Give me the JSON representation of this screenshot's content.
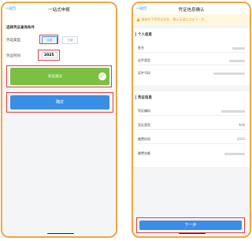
{
  "left": {
    "back_label": "<返回",
    "title": "一站式申报",
    "section_title": "选择凭证查询条件",
    "cert_type_label": "凭证类型",
    "cert_type_options": [
      "实收",
      "已缴"
    ],
    "cert_time_label": "凭证时间",
    "cert_time_value": "2025",
    "verify_label": "验证通过",
    "confirm_label": "确定"
  },
  "right": {
    "back_label": "<返回",
    "title": "凭证信息确认",
    "notice": "请核对下列凭证信息，确认无误后点击下一步。",
    "personal_section": "个人信息",
    "personal_rows": [
      {
        "label": "姓名"
      },
      {
        "label": "证件类型"
      },
      {
        "label": "证件号码"
      }
    ],
    "cert_section": "凭证信息",
    "cert_rows": [
      {
        "label": "凭证编码",
        "value": ""
      },
      {
        "label": "凭证类型",
        "value": "有效"
      },
      {
        "label": "缴费时间",
        "value": "2025"
      },
      {
        "label": "缴费金额",
        "value": ""
      }
    ],
    "next_label": "下一步"
  },
  "colors": {
    "frame": "#f0a540",
    "highlight": "#e04040",
    "primary": "#3a8ee6",
    "success": "#7cc043"
  }
}
